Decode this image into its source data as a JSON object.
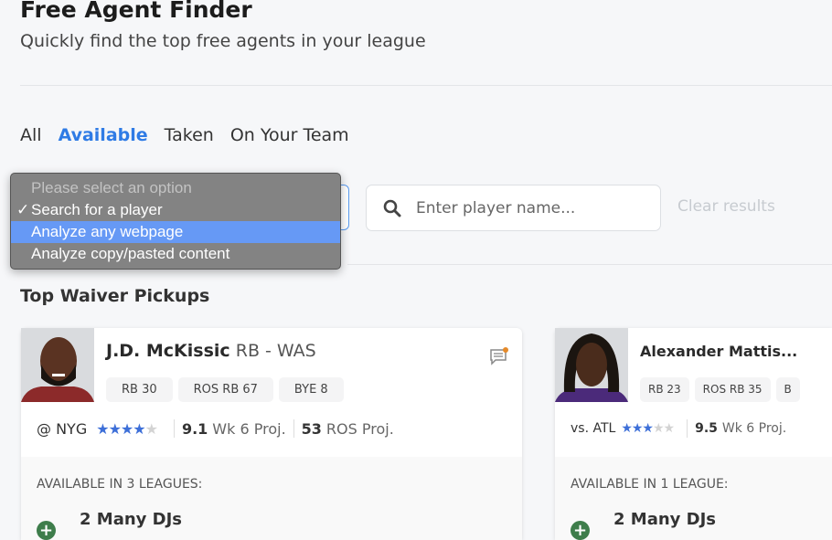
{
  "header": {
    "title": "Free Agent Finder",
    "subtitle": "Quickly find the top free agents in your league"
  },
  "tabs": [
    {
      "label": "All"
    },
    {
      "label": "Available",
      "active": true
    },
    {
      "label": "Taken"
    },
    {
      "label": "On Your Team"
    }
  ],
  "dropdown": {
    "placeholder": "Please select an option",
    "options": [
      "Search for a player",
      "Analyze any webpage",
      "Analyze copy/pasted content"
    ],
    "selected": "Search for a player",
    "highlighted": "Analyze any webpage"
  },
  "search": {
    "placeholder": "Enter player name...",
    "value": ""
  },
  "clear_label": "Clear results",
  "section_title": "Top Waiver Pickups",
  "colors": {
    "accent": "#2f7be5",
    "star": "#3d6fd8",
    "add": "#3e7d4b",
    "highlight": "#6699f5"
  },
  "cards": [
    {
      "name": "J.D. McKissic",
      "pos": "RB - WAS",
      "badges": [
        "RB 30",
        "ROS RB 67",
        "BYE 8"
      ],
      "opponent": "@ NYG",
      "rating": 4,
      "wk_proj": "9.1",
      "wk_label": "Wk 6 Proj.",
      "ros_proj": "53",
      "ros_label": "ROS Proj.",
      "available": "AVAILABLE IN 3 LEAGUES:",
      "league": "2 Many DJs"
    },
    {
      "name": "Alexander Mattis...",
      "pos": "",
      "badges": [
        "RB 23",
        "ROS RB 35",
        "B"
      ],
      "opponent": "vs. ATL",
      "rating": 3,
      "wk_proj": "9.5",
      "wk_label": "Wk 6 Proj.",
      "ros_proj": "",
      "ros_label": "",
      "available": "AVAILABLE IN 1 LEAGUE:",
      "league": "2 Many DJs"
    }
  ]
}
